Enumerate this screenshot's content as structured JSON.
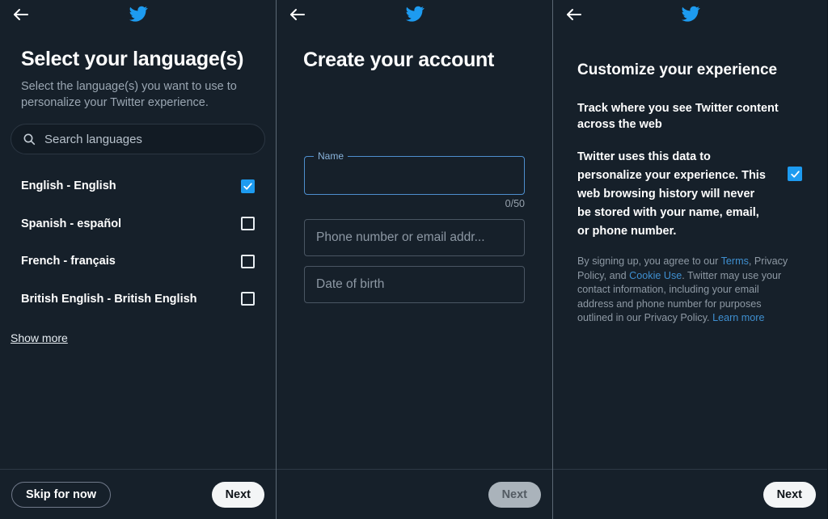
{
  "common": {
    "back_icon": "arrow-left-icon",
    "logo_icon": "twitter-bird-icon",
    "accent_blue": "#1d9bf0",
    "link_blue": "#3f8fd0",
    "background": "#16202a"
  },
  "panel1": {
    "title": "Select your language(s)",
    "subtitle": "Select the language(s) you want to use to personalize your Twitter experience.",
    "search": {
      "placeholder": "Search languages",
      "icon": "search-icon",
      "value": ""
    },
    "languages": [
      {
        "label": "English - English",
        "checked": true
      },
      {
        "label": "Spanish - español",
        "checked": false
      },
      {
        "label": "French - français",
        "checked": false
      },
      {
        "label": "British English - British English",
        "checked": false
      }
    ],
    "show_more": "Show more",
    "footer": {
      "skip_label": "Skip for now",
      "next_label": "Next"
    }
  },
  "panel2": {
    "title": "Create your account",
    "fields": {
      "name": {
        "label": "Name",
        "value": "",
        "counter": "0/50",
        "focused": true
      },
      "phone_or_email": {
        "placeholder": "Phone number or email addr...",
        "value": ""
      },
      "dob": {
        "placeholder": "Date of birth",
        "value": ""
      }
    },
    "footer": {
      "next_label": "Next",
      "next_disabled": true
    }
  },
  "panel3": {
    "title": "Customize your experience",
    "lead": "Track where you see Twitter content across the web",
    "consent_text": "Twitter uses this data to personalize your experience. This web browsing history will never be stored with your name, email, or phone number.",
    "consent_checked": true,
    "fine_print": {
      "part1": "By signing up, you agree to our ",
      "link1": "Terms",
      "part2": ", Privacy Policy, and ",
      "link2": "Cookie Use",
      "part3": ". Twitter may use your contact information, including your email address and phone number for purposes outlined in our Privacy Policy. ",
      "link3": "Learn more"
    },
    "footer": {
      "next_label": "Next"
    }
  }
}
